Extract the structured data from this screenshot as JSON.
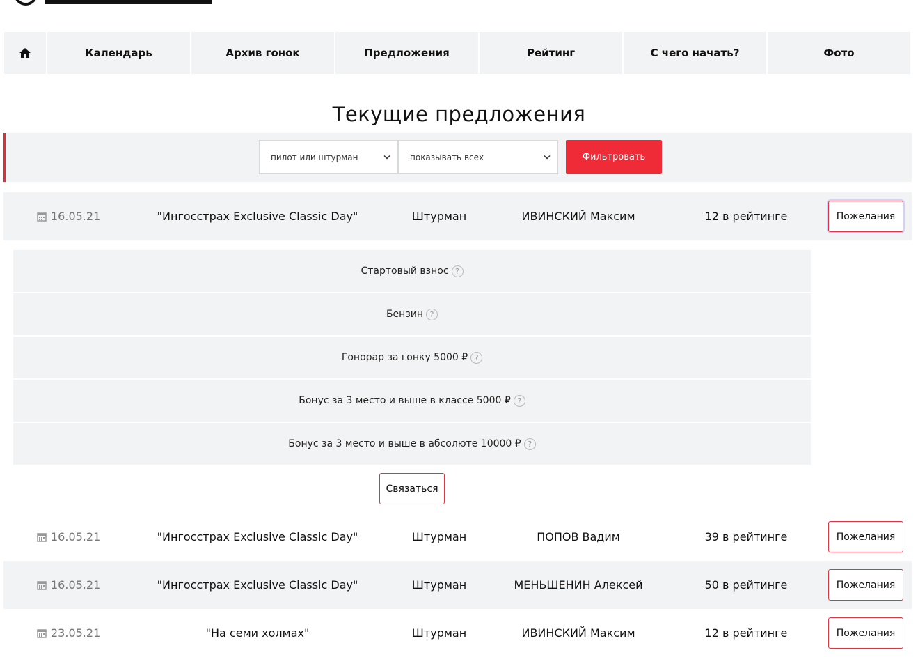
{
  "logo": {
    "icon": "brand-logo"
  },
  "nav": {
    "home_icon": "home-icon",
    "items": [
      {
        "label": "Календарь"
      },
      {
        "label": "Архив гонок"
      },
      {
        "label": "Предложения"
      },
      {
        "label": "Рейтинг"
      },
      {
        "label": "С чего начать?"
      },
      {
        "label": "Фото"
      }
    ]
  },
  "page_title": "Текущие предложения",
  "filter": {
    "role_select": "пилот или штурман",
    "show_select": "показывать всех",
    "submit_label": "Фильтровать",
    "accent": "#ee2b36"
  },
  "offers": [
    {
      "date": "16.05.21",
      "event": "\"Ингосстрах Exclusive Classic Day\"",
      "role": "Штурман",
      "name": "ИВИНСКИЙ Максим",
      "rating": "12 в рейтинге",
      "button": "Пожелания"
    },
    {
      "date": "16.05.21",
      "event": "\"Ингосстрах Exclusive Classic Day\"",
      "role": "Штурман",
      "name": "ПОПОВ Вадим",
      "rating": "39 в рейтинге",
      "button": "Пожелания"
    },
    {
      "date": "16.05.21",
      "event": "\"Ингосстрах Exclusive Classic Day\"",
      "role": "Штурман",
      "name": "МЕНЬШЕНИН Алексей",
      "rating": "50 в рейтинге",
      "button": "Пожелания"
    },
    {
      "date": "23.05.21",
      "event": "\"На семи холмах\"",
      "role": "Штурман",
      "name": "ИВИНСКИЙ Максим",
      "rating": "12 в рейтинге",
      "button": "Пожелания"
    }
  ],
  "details": {
    "items": [
      {
        "label": "Стартовый взнос"
      },
      {
        "label": "Бензин"
      },
      {
        "label": "Гонорар за гонку 5000 ₽"
      },
      {
        "label": "Бонус за 3 место и выше в классе 5000 ₽"
      },
      {
        "label": "Бонус за 3 место и выше в абсолюте 10000 ₽"
      }
    ],
    "help_glyph": "?",
    "contact_label": "Связаться"
  }
}
